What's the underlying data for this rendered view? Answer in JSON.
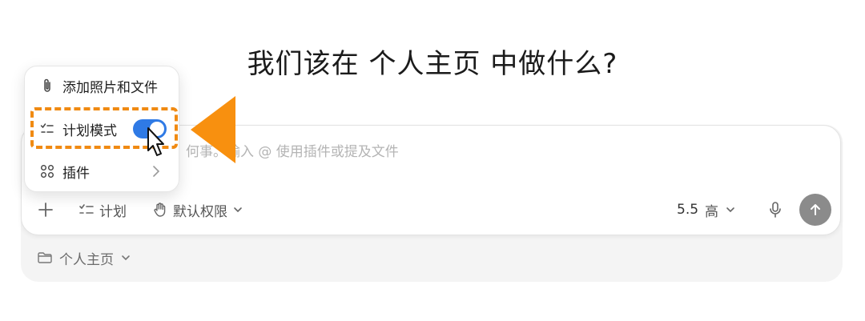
{
  "headline": "我们该在 个人主页 中做什么?",
  "composer": {
    "placeholder": "询问任何事。输入 @ 使用插件或提及文件",
    "visible_placeholder_part": "何事。输入 @ 使用插件或提及文件",
    "plan_label": "计划",
    "permissions_label": "默认权限",
    "model_version": "5.5",
    "effort_label": "高"
  },
  "project": {
    "label": "个人主页"
  },
  "menu": {
    "items": [
      {
        "label": "添加照片和文件",
        "icon": "paperclip-icon"
      },
      {
        "label": "计划模式",
        "icon": "checklist-icon",
        "toggle_on": true
      },
      {
        "label": "插件",
        "icon": "grid-icon",
        "has_submenu": true
      }
    ]
  },
  "colors": {
    "accent": "#2f7ae5",
    "highlight": "#f08a12",
    "send_button": "#8b8b8b"
  }
}
